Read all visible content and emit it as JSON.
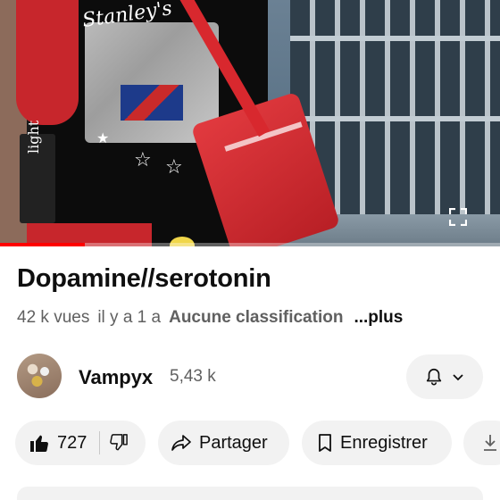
{
  "player": {
    "progress_fraction": 0.17,
    "shirt_text": "Stanley's",
    "book_text": "light"
  },
  "video": {
    "title": "Dopamine//serotonin",
    "views": "42 k vues",
    "age": "il y a 1 a",
    "classification": "Aucune classification",
    "more": "...plus"
  },
  "channel": {
    "name": "Vampyx",
    "subscribers": "5,43 k"
  },
  "actions": {
    "like_count": "727",
    "share_label": "Partager",
    "save_label": "Enregistrer"
  },
  "icons": [
    "fullscreen-icon",
    "bell-icon",
    "chevron-down-icon",
    "thumbs-up-icon",
    "thumbs-down-icon",
    "share-icon",
    "bookmark-icon",
    "download-icon"
  ],
  "colors": {
    "accent": "#ff0000",
    "pill_bg": "#f2f2f2",
    "text_primary": "#0f0f0f",
    "text_secondary": "#606060"
  }
}
